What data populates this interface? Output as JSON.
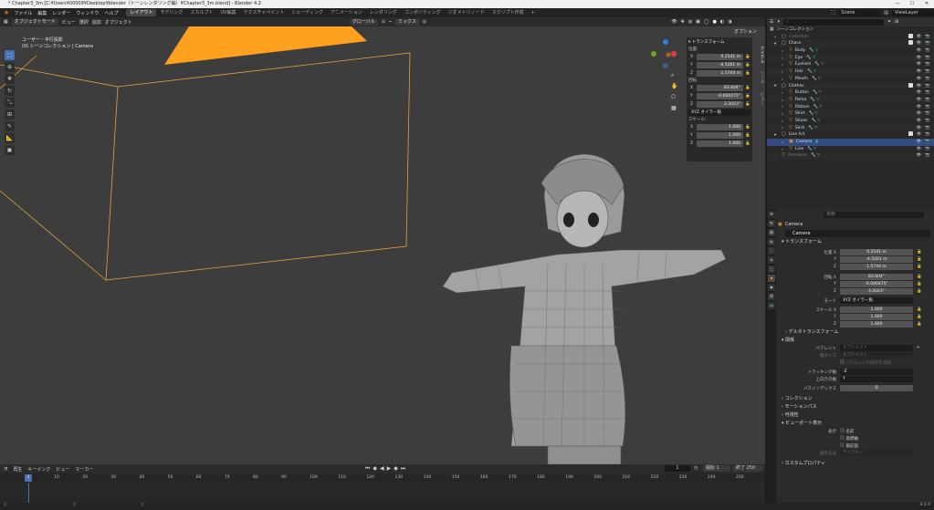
{
  "title": "* Chapter3_3m [C:¥Users¥00009¥Desktop¥blender（トーンレンダリング編）¥Chapter3_3m.blend] - Blender 4.2",
  "window_controls": [
    "—",
    "☐",
    "✕"
  ],
  "menu": {
    "items": [
      "ファイル",
      "編集",
      "レンダー",
      "ウィンドウ",
      "ヘルプ"
    ],
    "workspaces": [
      "レイアウト",
      "モデリング",
      "スカルプト",
      "UV編集",
      "テクスチャペイント",
      "シェーディング",
      "アニメーション",
      "レンダリング",
      "コンポジティング",
      "ジオメトリノード",
      "スクリプト作成"
    ],
    "active_workspace": 0,
    "scene": "Scene",
    "view_layer": "ViewLayer"
  },
  "viewport": {
    "mode": "オブジェクトモード",
    "menus": [
      "ビュー",
      "選択",
      "追加",
      "オブジェクト"
    ],
    "transform_orientation": "グローバル",
    "snap_mode": "ミックス",
    "options": "オプション",
    "info_line1": "ユーザー・平行投影",
    "info_line2": "(0) シーンコレクション | Camera"
  },
  "npanel": {
    "header": "トランスフォーム",
    "location_label": "位置:",
    "location": [
      {
        "axis": "X",
        "value": "0.2541 m"
      },
      {
        "axis": "Y",
        "value": "-4.5261 m"
      },
      {
        "axis": "Z",
        "value": "1.5744 m"
      }
    ],
    "rotation_label": "回転:",
    "rotation": [
      {
        "axis": "X",
        "value": "83.604°"
      },
      {
        "axis": "Y",
        "value": "-0.000475°"
      },
      {
        "axis": "Z",
        "value": "3.2023°"
      }
    ],
    "rotation_mode": "XYZ オイラー角",
    "scale_label": "スケール:",
    "scale": [
      {
        "axis": "X",
        "value": "1.000"
      },
      {
        "axis": "Y",
        "value": "1.000"
      },
      {
        "axis": "Z",
        "value": "1.000"
      }
    ],
    "tabs": [
      "アイテム",
      "ツール",
      "ビュー"
    ]
  },
  "outliner": {
    "header": "シーンコレクション",
    "rows": [
      {
        "name": "Collection",
        "depth": 1,
        "kind": "collection",
        "dim": true
      },
      {
        "name": "Chara",
        "depth": 1,
        "kind": "collection"
      },
      {
        "name": "Body",
        "depth": 2,
        "kind": "object"
      },
      {
        "name": "Eye",
        "depth": 2,
        "kind": "object"
      },
      {
        "name": "Eyelash",
        "depth": 2,
        "kind": "object"
      },
      {
        "name": "Hair",
        "depth": 2,
        "kind": "object"
      },
      {
        "name": "Mouth",
        "depth": 2,
        "kind": "object"
      },
      {
        "name": "Clothes",
        "depth": 1,
        "kind": "collection"
      },
      {
        "name": "Button",
        "depth": 2,
        "kind": "object"
      },
      {
        "name": "Parka",
        "depth": 2,
        "kind": "object"
      },
      {
        "name": "Ribbon",
        "depth": 2,
        "kind": "object"
      },
      {
        "name": "Shirt",
        "depth": 2,
        "kind": "object"
      },
      {
        "name": "Shoes",
        "depth": 2,
        "kind": "object"
      },
      {
        "name": "Skirt",
        "depth": 2,
        "kind": "object"
      },
      {
        "name": "Line Art",
        "depth": 1,
        "kind": "collection"
      },
      {
        "name": "Camera",
        "depth": 2,
        "kind": "camera",
        "selected": true
      },
      {
        "name": "Line",
        "depth": 2,
        "kind": "object"
      },
      {
        "name": "Armature",
        "depth": 1,
        "kind": "object",
        "dim": true
      }
    ]
  },
  "properties": {
    "search_placeholder": "検索",
    "object_name": "Camera",
    "object_field": "Camera",
    "section_transform": "トランスフォーム",
    "location": [
      {
        "label": "位置 X",
        "value": "0.2541 m"
      },
      {
        "label": "Y",
        "value": "-4.5261 m"
      },
      {
        "label": "Z",
        "value": "1.5744 m"
      }
    ],
    "rotation": [
      {
        "label": "回転 X",
        "value": "83.604°"
      },
      {
        "label": "Y",
        "value": "-0.000475°"
      },
      {
        "label": "Z",
        "value": "3.2023°"
      }
    ],
    "mode_label": "モード",
    "mode_value": "XYZ オイラー角",
    "scale": [
      {
        "label": "スケール X",
        "value": "1.000"
      },
      {
        "label": "Y",
        "value": "1.000"
      },
      {
        "label": "Z",
        "value": "1.000"
      }
    ],
    "section_delta": "デルタトランスフォーム",
    "section_relations": "関係",
    "parent_label": "ペアレント",
    "parent_placeholder": "オブジェクト",
    "parent_type_label": "親タイプ",
    "parent_type_value": "オブジェクト",
    "parent_checkbox": "ペアレントの頂点を可視",
    "tracking_axis_label": "トラッキング軸",
    "tracking_axis_value": "-Z",
    "up_axis_label": "上向きの軸",
    "up_axis_value": "Y",
    "pass_index_label": "パスインデックス",
    "pass_index_value": "0",
    "section_collections": "コレクション",
    "section_motion_paths": "モーションパス",
    "section_visibility": "可視性",
    "section_viewport_display": "ビューポート表示",
    "display_label": "表示",
    "display_options": [
      "名前",
      "座標軸",
      "最前面"
    ],
    "display_as_label": "表示方法",
    "display_as_value": "テクスチャ",
    "section_custom_props": "カスタムプロパティ"
  },
  "timeline": {
    "menus": [
      "再生",
      "キーイング",
      "ビュー",
      "マーカー"
    ],
    "current_frame": "1",
    "start_label": "開始",
    "start": "1",
    "end_label": "終了",
    "end": "250",
    "ticks": [
      "0",
      "10",
      "20",
      "30",
      "40",
      "50",
      "60",
      "70",
      "80",
      "90",
      "100",
      "110",
      "120",
      "130",
      "140",
      "150",
      "160",
      "170",
      "180",
      "190",
      "200",
      "210",
      "220",
      "230",
      "240",
      "250"
    ]
  },
  "status": {
    "version": "4.2.0"
  },
  "colors": {
    "accent": "#4772b3",
    "camera_frame": "#e3a13d",
    "camera_triangle": "#ffa01f",
    "viewport_bg": "#3d3d3d"
  }
}
